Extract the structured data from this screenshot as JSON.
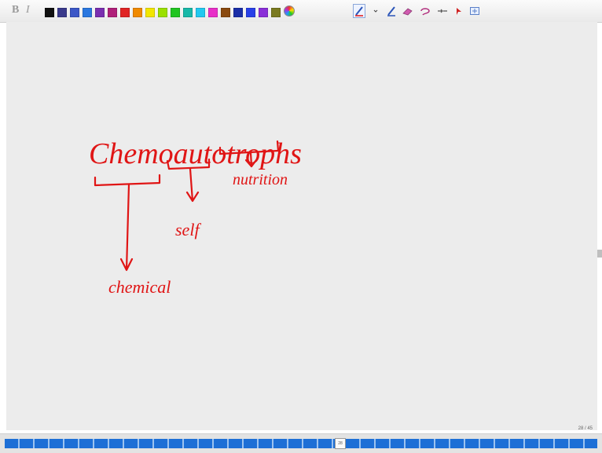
{
  "toolbar": {
    "bold_label": "B",
    "italic_label": "I",
    "swatch_colors": [
      "#111111",
      "#3a3a8c",
      "#3b57c7",
      "#2b78e0",
      "#7a2fb0",
      "#b0207a",
      "#e02424",
      "#f08a00",
      "#f2e600",
      "#9be000",
      "#22c522",
      "#18b8a8",
      "#22c8f0",
      "#e830c8",
      "#8a4a10",
      "#1b2fa8",
      "#2840e8",
      "#8a2fd8",
      "#7a7a20"
    ],
    "color_wheel_icon": "palette-icon",
    "tools": [
      "pen-tool-icon",
      "highlighter-icon",
      "eraser-icon",
      "lasso-icon",
      "pointer-icon",
      "insert-space-icon"
    ]
  },
  "canvas": {
    "background": "#ececec",
    "ink_color": "#e01515",
    "annotations": {
      "word": "Chemoautotrophs",
      "part_chemo": "chemical",
      "part_auto": "self",
      "part_troph": "nutrition"
    }
  },
  "pager": {
    "counter": "28 / 45",
    "current_page": "28",
    "track_color": "#1d6fd6"
  }
}
